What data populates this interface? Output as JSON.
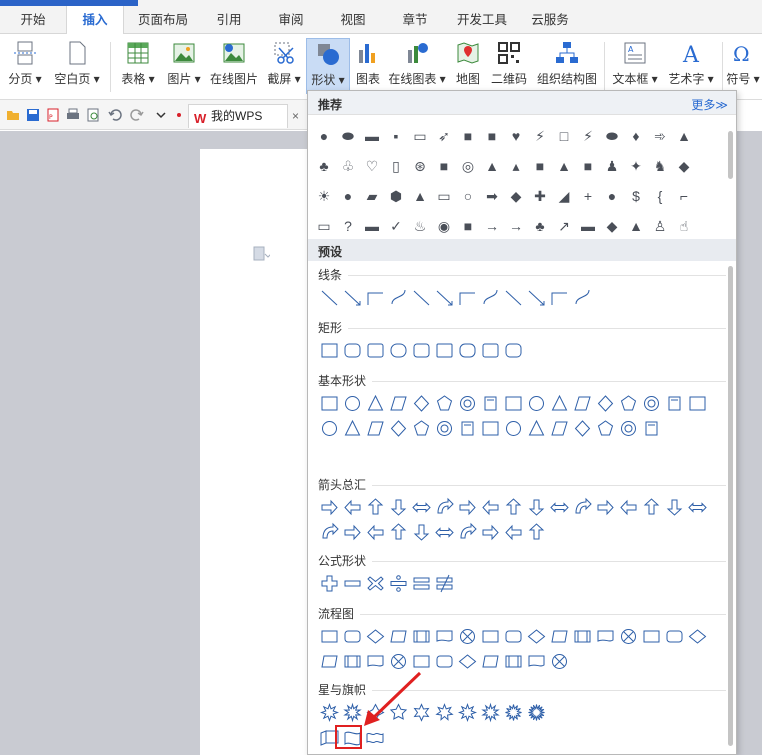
{
  "tabs": [
    "开始",
    "插入",
    "页面布局",
    "引用",
    "审阅",
    "视图",
    "章节",
    "开发工具",
    "云服务"
  ],
  "active_tab": "插入",
  "ribbon": {
    "page_break": "分页",
    "blank_page": "空白页",
    "table": "表格",
    "picture": "图片",
    "online_picture": "在线图片",
    "screenshot": "截屏",
    "shapes": "形状",
    "chart": "图表",
    "online_chart": "在线图表",
    "map": "地图",
    "qrcode": "二维码",
    "org_chart": "组织结构图",
    "textbox": "文本框",
    "wordart": "艺术字",
    "symbol": "符号"
  },
  "quick_access": {
    "doc_tab": "我的WPS",
    "w_glyph": "W"
  },
  "dropdown": {
    "recommended": "推荐",
    "more": "更多≫",
    "presets": "预设",
    "recommended_rows": [
      [
        "●",
        "⬬",
        "▬",
        "▪",
        "▭",
        "➶",
        "■",
        "■",
        "♥",
        "⚡",
        "□",
        "⚡",
        "⬬",
        "♦",
        "➾",
        "▲"
      ],
      [
        "♣",
        "♧",
        "♡",
        "▯",
        "⊛",
        "■",
        "◎",
        "▲",
        "▴",
        "■",
        "▲",
        "■",
        "♟",
        "✦",
        "♞",
        "◆"
      ],
      [
        "☀",
        "●",
        "▰",
        "⬢",
        "▲",
        "▭",
        "○",
        "➡",
        "◆",
        "✚",
        "◢",
        "+",
        "●",
        "$",
        "{",
        "⌐"
      ],
      [
        "▭",
        "?",
        "▬",
        "✓",
        "♨",
        "◉",
        "■",
        "→",
        "→",
        "♣",
        "↗",
        "▬",
        "◆",
        "▲",
        "♙",
        "☝"
      ]
    ],
    "categories": [
      {
        "title": "线条",
        "count": 12
      },
      {
        "title": "矩形",
        "count": 9
      },
      {
        "title": "基本形状",
        "count": 32
      },
      {
        "title": "箭头总汇",
        "count": 27
      },
      {
        "title": "公式形状",
        "count": 6
      },
      {
        "title": "流程图",
        "count": 28
      },
      {
        "title": "星与旗帜",
        "count": 13
      }
    ]
  }
}
